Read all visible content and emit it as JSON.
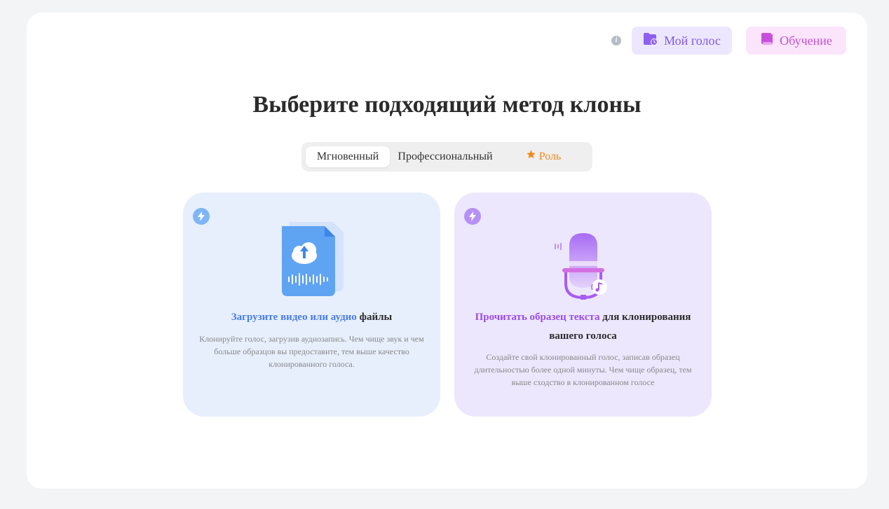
{
  "header": {
    "my_voice_label": "Мой голос",
    "learning_label": "Обучение"
  },
  "title": "Выберите подходящий метод клоны",
  "tabs": [
    {
      "label": "Мгновенный",
      "active": true
    },
    {
      "label": "Профессиональный",
      "active": false
    },
    {
      "label": "Роль",
      "active": false
    }
  ],
  "cards": [
    {
      "heading_highlight": "Загрузите видео или аудио",
      "heading_rest": " файлы",
      "description": "Клонируйте голос, загрузив аудиозапись. Чем чище звук и чем больше образцов вы предоставите, тем выше качество клонированного голоса.",
      "icon": "cloud-upload-file-icon"
    },
    {
      "heading_highlight": "Прочитать образец текста",
      "heading_rest": " для клонирования вашего голоса",
      "description": "Создайте свой клонированный голос, записав образец длительностью более одной минуты. Чем чище образец, тем выше сходство в клонированном голосе",
      "icon": "microphone-icon"
    }
  ],
  "colors": {
    "accent_blue": "#4a7ee0",
    "accent_purple": "#9a4de6",
    "role_orange": "#f0891e"
  }
}
